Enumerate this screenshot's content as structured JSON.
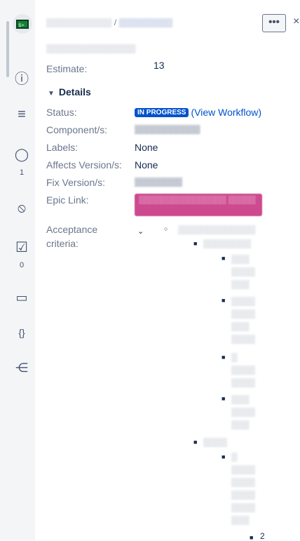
{
  "rail": {
    "icons": [
      {
        "name": "info-icon",
        "glyph": "ⓘ"
      },
      {
        "name": "filter-lines-icon",
        "glyph": "≡"
      },
      {
        "name": "comment-icon",
        "glyph": "◯"
      },
      {
        "name": "attachment-icon",
        "glyph": "⦸"
      },
      {
        "name": "checklist-icon",
        "glyph": "☑"
      },
      {
        "name": "calendar-icon",
        "glyph": "▭"
      },
      {
        "name": "braces-icon",
        "glyph": "{}"
      },
      {
        "name": "nodes-icon",
        "glyph": "⋲"
      }
    ],
    "comment_count": "1",
    "checklist_count": "0"
  },
  "header": {
    "breadcrumb_project": "▒▒▒▒▒▒▒▒▒▒▒",
    "breadcrumb_sep": "/",
    "breadcrumb_issue": "▒▒▒▒▒▒▒▒▒",
    "summary": "▒▒▒▒▒▒▒▒▒▒▒▒▒▒▒",
    "more_label": "•••",
    "close_label": "×"
  },
  "estimate": {
    "label": "Estimate:",
    "value": "13"
  },
  "details": {
    "title": "Details",
    "status_label": "Status:",
    "status_value": "IN PROGRESS",
    "workflow_link": "(View Workflow)",
    "component_label": "Component/s:",
    "component_value": "▒▒▒▒▒▒▒▒▒▒▒",
    "labels_label": "Labels:",
    "labels_value": "None",
    "affects_label": "Affects Version/s:",
    "affects_value": "None",
    "fix_label": "Fix Version/s:",
    "fix_value": "▒▒▒▒▒▒▒▒",
    "epic_label": "Epic Link:",
    "epic_value": "▒▒▒▒▒▒▒▒▒▒▒▒▒▒▒▒ ▒▒▒▒▒",
    "acceptance_label_1": "Acceptance",
    "acceptance_label_2": "criteria:"
  },
  "acceptance_tree": {
    "level1": "▒▒▒▒▒▒▒▒▒▒▒▒▒",
    "level2_a": "▒▒▒▒▒▒▒▒",
    "items_a": [
      "▒▒▒",
      "▒▒▒▒",
      "▒▒▒",
      "▒▒▒▒",
      "▒▒▒▒",
      "▒▒▒",
      "▒▒▒▒",
      "▒",
      "▒▒▒▒",
      "▒▒▒▒",
      "▒▒▒",
      "▒▒▒▒",
      "▒▒▒",
      "▒▒▒"
    ],
    "level2_b": "▒▒▒▒",
    "items_b": [
      "▒",
      "▒▒▒▒",
      "▒▒▒▒",
      "▒▒▒▒",
      "▒▒▒▒",
      "▒▒▒"
    ],
    "last_value": "2"
  }
}
